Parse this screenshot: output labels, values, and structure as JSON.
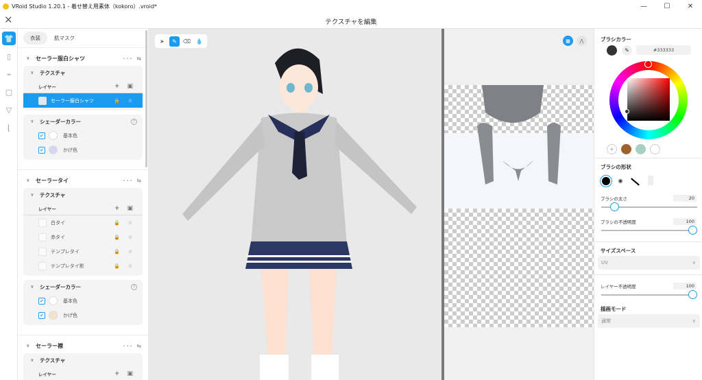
{
  "app": {
    "title": "VRoid Studio 1.20.1 - 着せ替え用素体（kokoro）.vroid*",
    "minimize": "—",
    "maximize": "☐",
    "close": "✕"
  },
  "header": {
    "title": "テクスチャを編集",
    "close": "✕"
  },
  "rail": [
    "shirt-icon",
    "pants-icon",
    "accessory-icon",
    "onepiece-icon",
    "underwear-icon",
    "shoes-icon"
  ],
  "tabs": [
    {
      "label": "衣装"
    },
    {
      "label": "肌マスク"
    }
  ],
  "sections": [
    {
      "title": "セーラー服白シャツ",
      "texture": "テクスチャ",
      "layer_label": "レイヤー",
      "layers": [
        "セーラー服白シャツ"
      ],
      "shader": "シェーダーカラー",
      "colors": [
        {
          "label": "基本色",
          "color": "#ffffff"
        },
        {
          "label": "かげ色",
          "color": "#d4d6f2"
        }
      ]
    },
    {
      "title": "セーラータイ",
      "texture": "テクスチャ",
      "layer_label": "レイヤー",
      "layers": [
        "白タイ",
        "赤タイ",
        "テンプレタイ",
        "テンプレタイ影"
      ],
      "shader": "シェーダーカラー",
      "colors": [
        {
          "label": "基本色",
          "color": "#ffffff"
        },
        {
          "label": "かげ色",
          "color": "#f5e2c8"
        }
      ]
    },
    {
      "title": "セーラー襟",
      "texture": "テクスチャ",
      "layer_label": "レイヤー"
    }
  ],
  "right": {
    "brush_color_label": "ブラシカラー",
    "hex": "#333333",
    "current_color": "#333333",
    "presets": [
      "#a0622d",
      "#a8cfc4",
      "#ffffff"
    ],
    "brush_shape_label": "ブラシの形状",
    "size_label": "ブラシの太さ",
    "size_value": "20",
    "size_fraction": 0.1,
    "opacity_label": "ブラシの不透明度",
    "opacity_value": "100",
    "opacity_fraction": 1.0,
    "size_space_label": "サイズスペース",
    "size_space_value": "UV",
    "layer_opacity_label": "レイヤー不透明度",
    "layer_opacity_value": "100",
    "layer_opacity_fraction": 1.0,
    "draw_mode_label": "描画モード",
    "draw_mode_value": "通常"
  }
}
